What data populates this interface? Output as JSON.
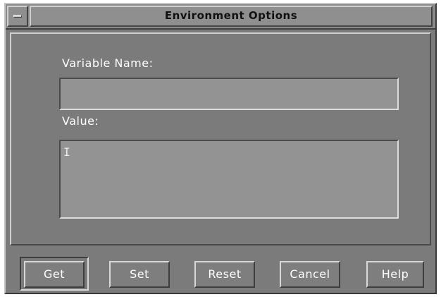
{
  "window": {
    "title": "Environment Options"
  },
  "form": {
    "variable_name_label": "Variable Name:",
    "variable_name_value": "",
    "value_label": "Value:",
    "value_value": "",
    "text_cursor": "I"
  },
  "buttons": {
    "get": "Get",
    "set": "Set",
    "reset": "Reset",
    "cancel": "Cancel",
    "help": "Help"
  },
  "icons": {
    "window_menu": "window-menu-icon"
  },
  "colors": {
    "window_bg": "#7b7b7b",
    "field_bg": "#939393",
    "label_text": "#ffffff"
  }
}
